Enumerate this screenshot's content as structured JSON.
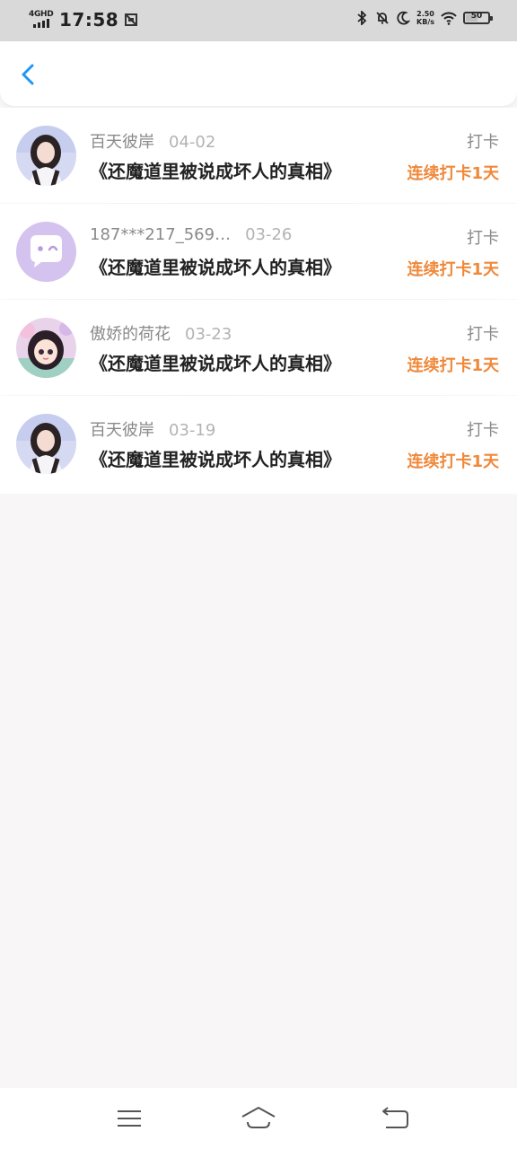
{
  "status_bar": {
    "network": "4GHD",
    "time": "17:58",
    "speed_value": "2.50",
    "speed_unit": "KB/s",
    "battery": "50"
  },
  "header": {
    "back_icon": "chevron-left-icon"
  },
  "records": [
    {
      "username": "百天彼岸",
      "date": "04-02",
      "book": "《还魔道里被说成坏人的真相》",
      "checkin": "打卡",
      "streak": "连续打卡1天",
      "avatar": "photo-girl"
    },
    {
      "username": "187***217_569…",
      "date": "03-26",
      "book": "《还魔道里被说成坏人的真相》",
      "checkin": "打卡",
      "streak": "连续打卡1天",
      "avatar": "default-chat-bubble"
    },
    {
      "username": "傲娇的荷花",
      "date": "03-23",
      "book": "《还魔道里被说成坏人的真相》",
      "checkin": "打卡",
      "streak": "连续打卡1天",
      "avatar": "anime-girl"
    },
    {
      "username": "百天彼岸",
      "date": "03-19",
      "book": "《还魔道里被说成坏人的真相》",
      "checkin": "打卡",
      "streak": "连续打卡1天",
      "avatar": "photo-girl"
    }
  ],
  "colors": {
    "accent_blue": "#2196f3",
    "streak_orange": "#f0883a",
    "page_bg": "#f8f6f7"
  },
  "bottom_nav": [
    "menu-icon",
    "home-icon",
    "back-icon"
  ]
}
